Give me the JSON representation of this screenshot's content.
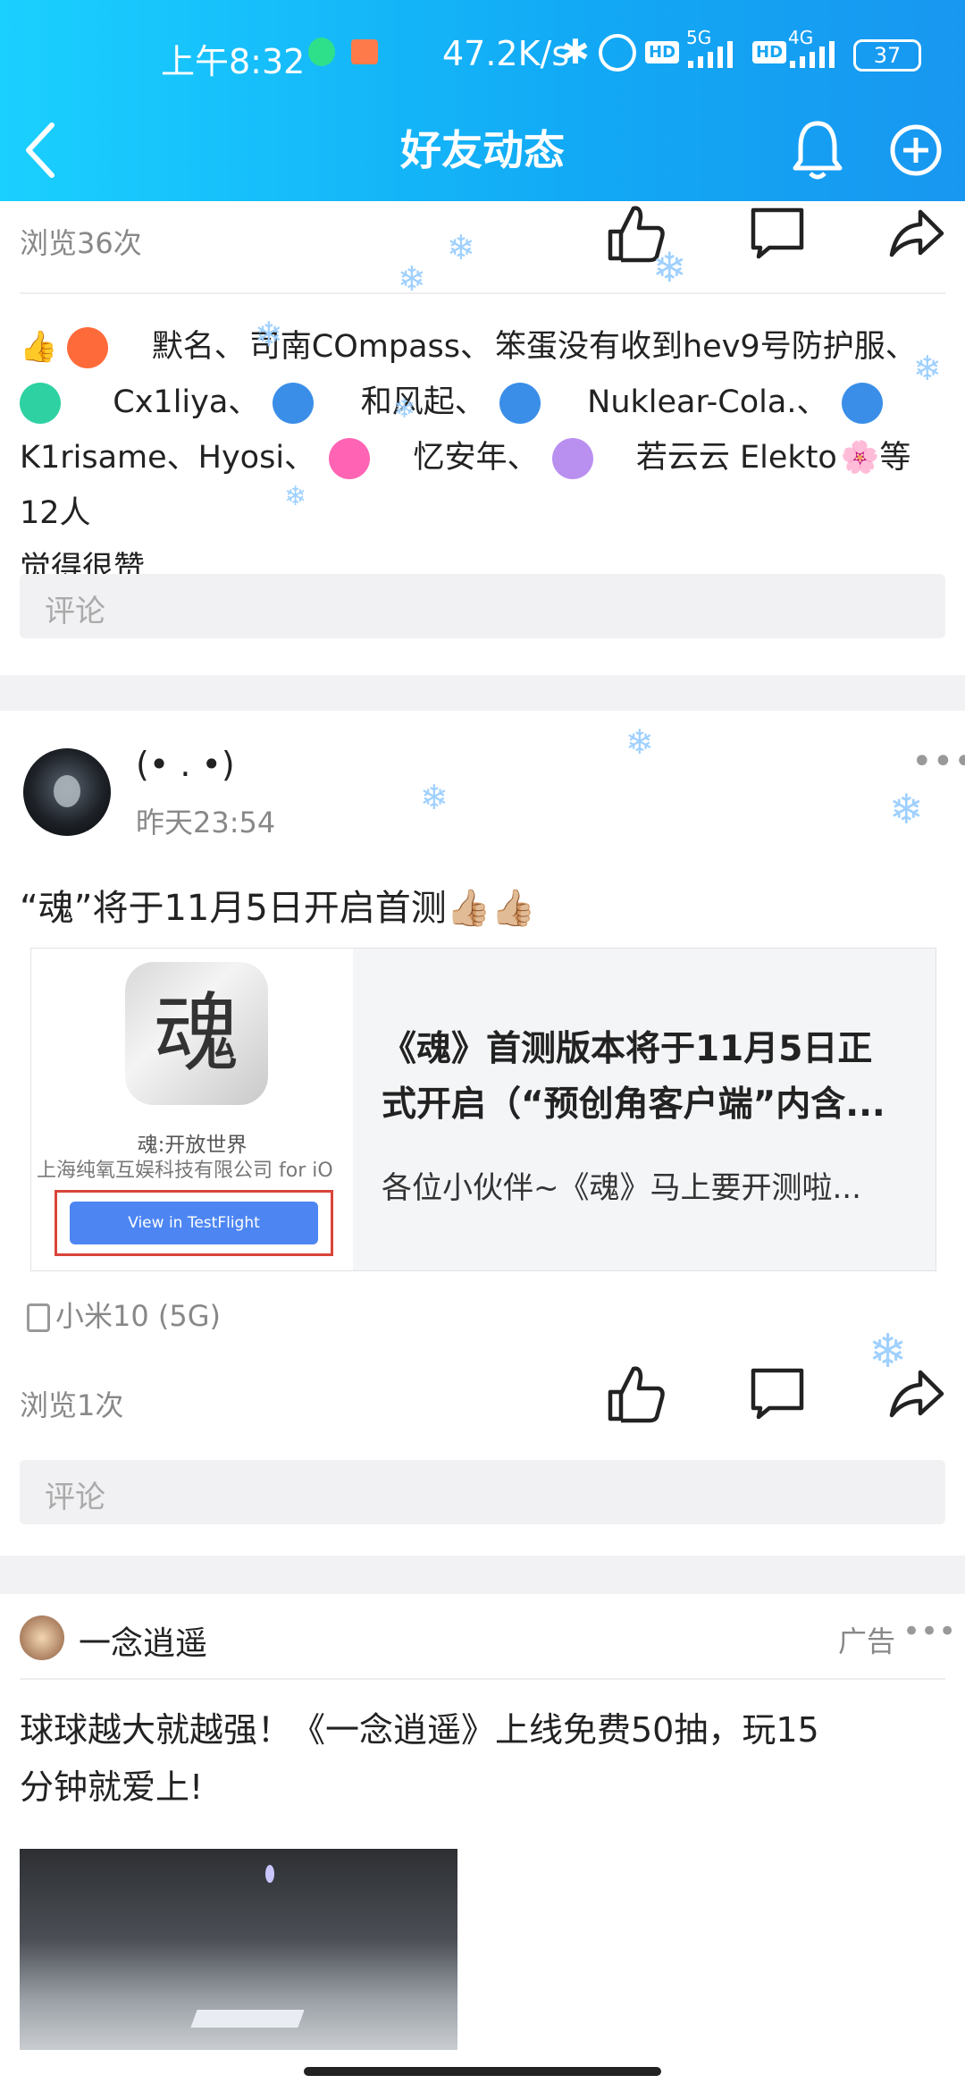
{
  "status_bar": {
    "time": "上午8:32",
    "net_speed": "47.2K/s",
    "battery": "37",
    "sig1": "5G",
    "sig2": "4G",
    "hd": "HD"
  },
  "header": {
    "title": "好友动态"
  },
  "post1": {
    "views": "浏览36次",
    "likes_prefix_names": [
      "默名、",
      "司南COmpass、",
      "笨蛋没有收到hev9号防护服、"
    ],
    "likes_line2": [
      "Cx1liya、",
      "和风起、",
      "Nuklear-Cola.、"
    ],
    "likes_line3a": "K1risame、Hyosi、",
    "likes_line3b": "忆安年、",
    "likes_line3c": "若云云 Elekto",
    "likes_line3d": "等12人",
    "likes_line4": "觉得很赞",
    "comment_placeholder": "评论"
  },
  "post2": {
    "username": "(•  .  •)",
    "time": "昨天23:54",
    "text": "“魂”将于11月5日开启首测👍🏼👍🏼",
    "link": {
      "app_icon_char": "魂",
      "app_name": "魂:开放世界",
      "company": "上海纯氧互娱科技有限公司 for iO",
      "testflight_btn": "View in TestFlight",
      "title_line1": "《魂》首测版本将于11月5日正",
      "title_line2": "式开启（“预创角客户端”内含...",
      "desc": "各位小伙伴~《魂》马上要开测啦..."
    },
    "device": "小米10 (5G)",
    "views": "浏览1次",
    "comment_placeholder": "评论"
  },
  "ad": {
    "username": "一念逍遥",
    "badge": "广告",
    "text_line1": "球球越大就越强！《一念逍遥》上线免费50抽，玩15",
    "text_line2": "分钟就爱上!"
  },
  "icons": {
    "back": "back-arrow-icon",
    "bell": "bell-icon",
    "add": "add-circle-icon",
    "like": "thumbs-up-icon",
    "comment": "comment-icon",
    "share": "share-icon",
    "more": "more-dots-icon",
    "snow": "snowflake-icon"
  },
  "colors": {
    "header_start": "#1ad0ff",
    "header_end": "#1897f0",
    "accent": "#3a8ee8"
  }
}
